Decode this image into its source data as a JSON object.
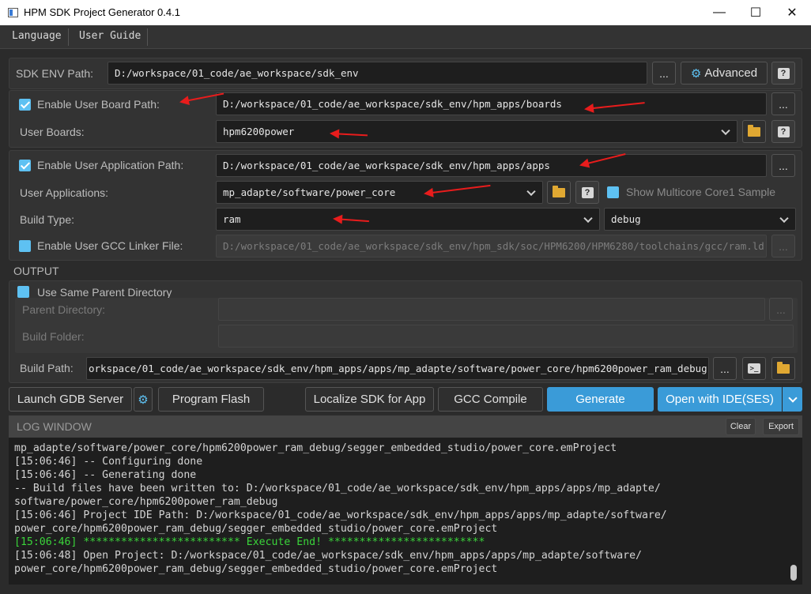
{
  "window": {
    "title": "HPM SDK Project Generator 0.4.1",
    "minimize": "—",
    "maximize": "☐",
    "close": "✕"
  },
  "menu": {
    "items": [
      "Language",
      "User Guide"
    ]
  },
  "sdk": {
    "label": "SDK ENV Path:",
    "value": "D:/workspace/01_code/ae_workspace/sdk_env",
    "browse": "...",
    "advanced": "Advanced",
    "help": "?"
  },
  "board": {
    "enable_label": "Enable User Board Path:",
    "enable_checked": true,
    "path_value": "D:/workspace/01_code/ae_workspace/sdk_env/hpm_apps/boards",
    "browse": "...",
    "boards_label": "User Boards:",
    "boards_value": "hpm6200power",
    "help": "?"
  },
  "app": {
    "enable_label": "Enable User Application Path:",
    "enable_checked": true,
    "path_value": "D:/workspace/01_code/ae_workspace/sdk_env/hpm_apps/apps",
    "browse": "...",
    "apps_label": "User Applications:",
    "apps_value": "mp_adapte/software/power_core",
    "help": "?",
    "multicore_label": "Show Multicore Core1 Sample",
    "build_type_label": "Build Type:",
    "build_type_value": "ram",
    "build_config_value": "debug",
    "linker_label": "Enable User GCC Linker File:",
    "linker_value": "D:/workspace/01_code/ae_workspace/sdk_env/hpm_sdk/soc/HPM6200/HPM6280/toolchains/gcc/ram.ld",
    "linker_browse": "..."
  },
  "output": {
    "section_label": "OUTPUT",
    "same_parent_label": "Use Same Parent Directory",
    "parent_dir_label": "Parent Directory:",
    "parent_browse": "...",
    "build_folder_label": "Build Folder:",
    "build_path_label": "Build Path:",
    "build_path_value": "orkspace/01_code/ae_workspace/sdk_env/hpm_apps/apps/mp_adapte/software/power_core/hpm6200power_ram_debug",
    "build_browse": "..."
  },
  "actions": {
    "launch_gdb": "Launch GDB Server",
    "program_flash": "Program Flash",
    "localize_sdk": "Localize SDK for App",
    "gcc_compile": "GCC Compile",
    "generate": "Generate",
    "open_ide": "Open with IDE(SES)"
  },
  "log": {
    "title": "LOG WINDOW",
    "clear": "Clear",
    "export": "Export",
    "lines": [
      {
        "text": "mp_adapte/software/power_core/hpm6200power_ram_debug/segger_embedded_studio/power_core.emProject",
        "ok": false
      },
      {
        "text": "[15:06:46] -- Configuring done",
        "ok": false
      },
      {
        "text": "[15:06:46] -- Generating done",
        "ok": false
      },
      {
        "text": "-- Build files have been written to: D:/workspace/01_code/ae_workspace/sdk_env/hpm_apps/apps/mp_adapte/",
        "ok": false
      },
      {
        "text": "software/power_core/hpm6200power_ram_debug",
        "ok": false
      },
      {
        "text": "[15:06:46] Project IDE Path: D:/workspace/01_code/ae_workspace/sdk_env/hpm_apps/apps/mp_adapte/software/",
        "ok": false
      },
      {
        "text": "power_core/hpm6200power_ram_debug/segger_embedded_studio/power_core.emProject",
        "ok": false
      },
      {
        "text": "[15:06:46] ************************* Execute End! *************************",
        "ok": true
      },
      {
        "text": "[15:06:48] Open Project: D:/workspace/01_code/ae_workspace/sdk_env/hpm_apps/apps/mp_adapte/software/",
        "ok": false
      },
      {
        "text": "power_core/hpm6200power_ram_debug/segger_embedded_studio/power_core.emProject",
        "ok": false
      }
    ]
  },
  "colors": {
    "accent": "#3a9bd8",
    "checkbox": "#5ec1f2",
    "annotation": "#e81c1c",
    "log_ok": "#3ad43a"
  }
}
